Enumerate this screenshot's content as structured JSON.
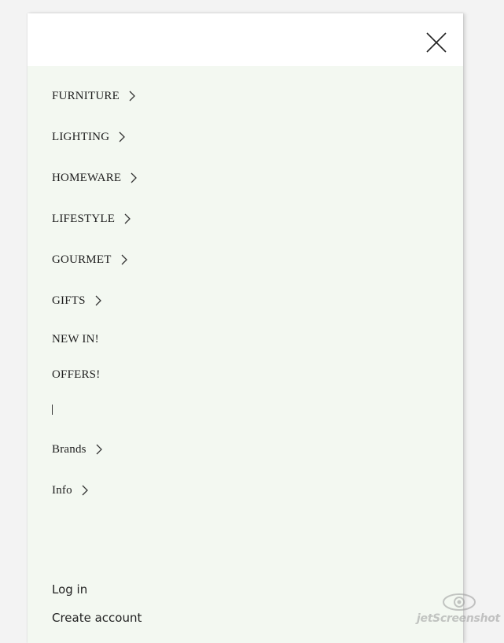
{
  "menu": {
    "close_label": "Close menu",
    "items": [
      {
        "label": "FURNITURE",
        "has_submenu": true
      },
      {
        "label": "LIGHTING",
        "has_submenu": true
      },
      {
        "label": "HOMEWARE",
        "has_submenu": true
      },
      {
        "label": "LIFESTYLE",
        "has_submenu": true
      },
      {
        "label": "GOURMET",
        "has_submenu": true
      },
      {
        "label": "GIFTS",
        "has_submenu": true
      },
      {
        "label": "NEW IN!",
        "has_submenu": false
      },
      {
        "label": "OFFERS!",
        "has_submenu": false
      }
    ],
    "secondary_items": [
      {
        "label": "Brands",
        "has_submenu": true
      },
      {
        "label": "Info",
        "has_submenu": true
      }
    ]
  },
  "account": {
    "login_label": "Log in",
    "create_label": "Create account"
  },
  "watermark": {
    "text": "jetScreenshot"
  },
  "colors": {
    "page_background": "#f3f3f3",
    "drawer_background": "#f3f8f1",
    "header_background": "#ffffff",
    "text": "#1e1e1e"
  }
}
